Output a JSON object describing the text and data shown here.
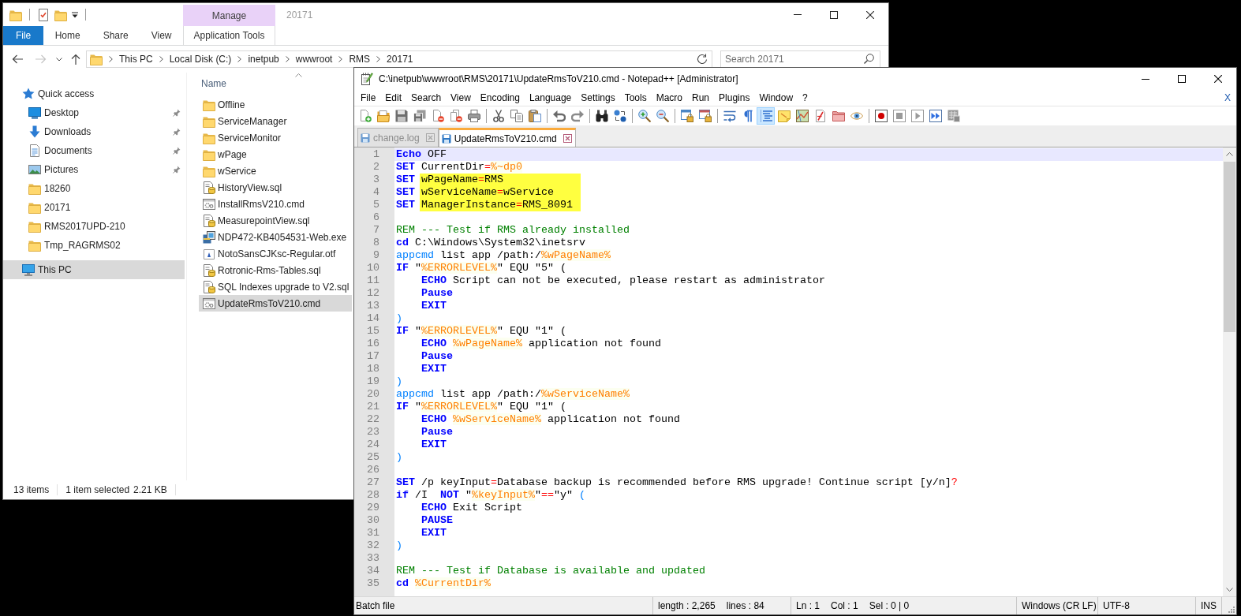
{
  "explorer": {
    "title": "20171",
    "ribbon": {
      "context_group": "Manage",
      "tabs": [
        {
          "label": "File",
          "kind": "file",
          "selected": false
        },
        {
          "label": "Home",
          "kind": "standard",
          "selected": false
        },
        {
          "label": "Share",
          "kind": "standard",
          "selected": false
        },
        {
          "label": "View",
          "kind": "standard",
          "selected": false
        },
        {
          "label": "Application Tools",
          "kind": "contextual",
          "selected": false
        }
      ]
    },
    "navigation": [
      {
        "kind": "back",
        "disabled": false
      },
      {
        "kind": "forward",
        "disabled": true
      },
      {
        "kind": "recent",
        "disabled": false
      },
      {
        "kind": "up",
        "disabled": false
      }
    ],
    "address": [
      "This PC",
      "Local Disk (C:)",
      "inetpub",
      "wwwroot",
      "RMS",
      "20171"
    ],
    "search": {
      "placeholder": "Search 20171"
    },
    "sidebar": [
      {
        "label": "Quick access",
        "kind": "star",
        "pinned": false,
        "selected": false,
        "children": [
          {
            "label": "Desktop",
            "kind": "desktop",
            "pinned": true,
            "selected": false
          },
          {
            "label": "Downloads",
            "kind": "download",
            "pinned": true,
            "selected": false
          },
          {
            "label": "Documents",
            "kind": "documents",
            "pinned": true,
            "selected": false
          },
          {
            "label": "Pictures",
            "kind": "pictures",
            "pinned": true,
            "selected": false
          },
          {
            "label": "18260",
            "kind": "folder",
            "pinned": false,
            "selected": false
          },
          {
            "label": "20171",
            "kind": "folder",
            "pinned": false,
            "selected": false
          },
          {
            "label": "RMS2017UPD-210",
            "kind": "folder",
            "pinned": false,
            "selected": false
          },
          {
            "label": "Tmp_RAGRMS02",
            "kind": "folder",
            "pinned": false,
            "selected": false
          }
        ]
      },
      {
        "label": "This PC",
        "kind": "pc",
        "pinned": false,
        "selected": true
      }
    ],
    "file_list": {
      "column": "Name",
      "sort_ascending": true,
      "items": [
        {
          "name": "Offline",
          "kind": "folder",
          "selected": false
        },
        {
          "name": "ServiceManager",
          "kind": "folder",
          "selected": false
        },
        {
          "name": "ServiceMonitor",
          "kind": "folder",
          "selected": false
        },
        {
          "name": "wPage",
          "kind": "folder",
          "selected": false
        },
        {
          "name": "wService",
          "kind": "folder",
          "selected": false
        },
        {
          "name": "HistoryView.sql",
          "kind": "sql",
          "selected": false
        },
        {
          "name": "InstallRmsV210.cmd",
          "kind": "cmd",
          "selected": false
        },
        {
          "name": "MeasurepointView.sql",
          "kind": "sql",
          "selected": false
        },
        {
          "name": "NDP472-KB4054531-Web.exe",
          "kind": "exe",
          "selected": false
        },
        {
          "name": "NotoSansCJKsc-Regular.otf",
          "kind": "font",
          "selected": false
        },
        {
          "name": "Rotronic-Rms-Tables.sql",
          "kind": "sql",
          "selected": false
        },
        {
          "name": "SQL Indexes upgrade to V2.sql",
          "kind": "sql",
          "selected": false
        },
        {
          "name": "UpdateRmsToV210.cmd",
          "kind": "cmd",
          "selected": true
        }
      ]
    },
    "status_bar": {
      "count": "13 items",
      "selection": "1 item selected",
      "size": "2.21 KB"
    }
  },
  "notepad": {
    "title": "C:\\inetpub\\wwwroot\\RMS\\20171\\UpdateRmsToV210.cmd - Notepad++ [Administrator]",
    "menu": [
      "File",
      "Edit",
      "Search",
      "View",
      "Encoding",
      "Language",
      "Settings",
      "Tools",
      "Macro",
      "Run",
      "Plugins",
      "Window",
      "?"
    ],
    "close_document": "X",
    "toolbar": [
      [
        {
          "kind": "new",
          "pressed": false
        },
        {
          "kind": "open",
          "pressed": false
        },
        {
          "kind": "save",
          "pressed": false
        },
        {
          "kind": "save_all",
          "pressed": false
        },
        {
          "kind": "close",
          "pressed": false
        },
        {
          "kind": "close_all",
          "pressed": false
        },
        {
          "kind": "print",
          "pressed": false
        }
      ],
      [
        {
          "kind": "cut",
          "pressed": false
        },
        {
          "kind": "copy",
          "pressed": false
        },
        {
          "kind": "paste",
          "pressed": false
        }
      ],
      [
        {
          "kind": "undo",
          "pressed": false
        },
        {
          "kind": "redo",
          "pressed": false
        }
      ],
      [
        {
          "kind": "find",
          "pressed": false
        },
        {
          "kind": "replace",
          "pressed": false
        }
      ],
      [
        {
          "kind": "zoom_in",
          "pressed": false
        },
        {
          "kind": "zoom_out",
          "pressed": false
        }
      ],
      [
        {
          "kind": "sync_vertical",
          "pressed": false
        },
        {
          "kind": "sync_horizontal",
          "pressed": false
        }
      ],
      [
        {
          "kind": "word_wrap",
          "pressed": false
        },
        {
          "kind": "all_characters",
          "pressed": false
        },
        {
          "kind": "indent_guide",
          "pressed": true
        },
        {
          "kind": "user_language",
          "pressed": false
        },
        {
          "kind": "document_map",
          "pressed": false
        },
        {
          "kind": "function_list",
          "pressed": false
        },
        {
          "kind": "folder_workspace",
          "pressed": false
        },
        {
          "kind": "monitoring",
          "pressed": false
        }
      ],
      [
        {
          "kind": "record",
          "pressed": false
        },
        {
          "kind": "stop",
          "pressed": false
        },
        {
          "kind": "playback",
          "pressed": false
        },
        {
          "kind": "run_multiple",
          "pressed": false
        },
        {
          "kind": "save_macro",
          "pressed": false
        }
      ]
    ],
    "tabs": [
      {
        "label": "change.log",
        "selected": false
      },
      {
        "label": "UpdateRmsToV210.cmd",
        "selected": true
      }
    ],
    "editor": {
      "lines": [
        {
          "number": "1",
          "current": true,
          "tokens": [
            {
              "text": "Echo",
              "kind": "keyword"
            },
            {
              "text": " OFF",
              "kind": "plain"
            }
          ]
        },
        {
          "number": "2",
          "current": false,
          "tokens": [
            {
              "text": "SET",
              "kind": "keyword"
            },
            {
              "text": " CurrentDir",
              "kind": "plain"
            },
            {
              "text": "=",
              "kind": "operator"
            },
            {
              "text": "%~dp0",
              "kind": "variable"
            }
          ]
        },
        {
          "number": "3",
          "current": false,
          "tokens": [
            {
              "text": "SET ",
              "kind": "keyword"
            }
          ],
          "marked": [
            {
              "text": "wPageName",
              "kind": "plain"
            },
            {
              "text": "=",
              "kind": "operator"
            },
            {
              "text": "RMS",
              "kind": "plain"
            }
          ]
        },
        {
          "number": "4",
          "current": false,
          "tokens": [
            {
              "text": "SET ",
              "kind": "keyword"
            }
          ],
          "marked": [
            {
              "text": "wServiceName",
              "kind": "plain"
            },
            {
              "text": "=",
              "kind": "operator"
            },
            {
              "text": "wService",
              "kind": "plain"
            }
          ]
        },
        {
          "number": "5",
          "current": false,
          "tokens": [
            {
              "text": "SET ",
              "kind": "keyword"
            }
          ],
          "marked": [
            {
              "text": "ManagerInstance",
              "kind": "plain"
            },
            {
              "text": "=",
              "kind": "operator"
            },
            {
              "text": "RMS_8091",
              "kind": "plain"
            }
          ]
        },
        {
          "number": "6",
          "current": false
        },
        {
          "number": "7",
          "current": false,
          "tokens": [
            {
              "text": "REM --- Test if RMS already installed",
              "kind": "comment"
            }
          ]
        },
        {
          "number": "8",
          "current": false,
          "tokens": [
            {
              "text": "cd",
              "kind": "keyword"
            },
            {
              "text": " C:\\Windows\\System32\\inetsrv",
              "kind": "plain"
            }
          ]
        },
        {
          "number": "9",
          "current": false,
          "tokens": [
            {
              "text": "appcmd",
              "kind": "command"
            },
            {
              "text": " list app /path:/",
              "kind": "plain"
            },
            {
              "text": "%wPageName%",
              "kind": "variable"
            }
          ]
        },
        {
          "number": "10",
          "current": false,
          "tokens": [
            {
              "text": "IF",
              "kind": "keyword"
            },
            {
              "text": " \"",
              "kind": "plain"
            },
            {
              "text": "%ERRORLEVEL%",
              "kind": "variable"
            },
            {
              "text": "\" EQU \"5\" (",
              "kind": "plain"
            }
          ]
        },
        {
          "number": "11",
          "current": false,
          "tokens": [
            {
              "text": "    ECHO",
              "kind": "keyword"
            },
            {
              "text": " Script can not be executed, please restart as administrator",
              "kind": "plain"
            }
          ]
        },
        {
          "number": "12",
          "current": false,
          "tokens": [
            {
              "text": "    Pause",
              "kind": "keyword"
            }
          ]
        },
        {
          "number": "13",
          "current": false,
          "tokens": [
            {
              "text": "    EXIT",
              "kind": "keyword"
            }
          ]
        },
        {
          "number": "14",
          "current": false,
          "tokens": [
            {
              "text": ")",
              "kind": "bracket"
            }
          ]
        },
        {
          "number": "15",
          "current": false,
          "tokens": [
            {
              "text": "IF",
              "kind": "keyword"
            },
            {
              "text": " \"",
              "kind": "plain"
            },
            {
              "text": "%ERRORLEVEL%",
              "kind": "variable"
            },
            {
              "text": "\" EQU \"1\" (",
              "kind": "plain"
            }
          ]
        },
        {
          "number": "16",
          "current": false,
          "tokens": [
            {
              "text": "    ECHO ",
              "kind": "keyword"
            },
            {
              "text": "%wPageName%",
              "kind": "variable"
            },
            {
              "text": " application not found",
              "kind": "plain"
            }
          ]
        },
        {
          "number": "17",
          "current": false,
          "tokens": [
            {
              "text": "    Pause",
              "kind": "keyword"
            }
          ]
        },
        {
          "number": "18",
          "current": false,
          "tokens": [
            {
              "text": "    EXIT",
              "kind": "keyword"
            }
          ]
        },
        {
          "number": "19",
          "current": false,
          "tokens": [
            {
              "text": ")",
              "kind": "bracket"
            }
          ]
        },
        {
          "number": "20",
          "current": false,
          "tokens": [
            {
              "text": "appcmd",
              "kind": "command"
            },
            {
              "text": " list app /path:/",
              "kind": "plain"
            },
            {
              "text": "%wServiceName%",
              "kind": "variable"
            }
          ]
        },
        {
          "number": "21",
          "current": false,
          "tokens": [
            {
              "text": "IF",
              "kind": "keyword"
            },
            {
              "text": " \"",
              "kind": "plain"
            },
            {
              "text": "%ERRORLEVEL%",
              "kind": "variable"
            },
            {
              "text": "\" EQU \"1\" (",
              "kind": "plain"
            }
          ]
        },
        {
          "number": "22",
          "current": false,
          "tokens": [
            {
              "text": "    ECHO ",
              "kind": "keyword"
            },
            {
              "text": "%wServiceName%",
              "kind": "variable"
            },
            {
              "text": " application not found",
              "kind": "plain"
            }
          ]
        },
        {
          "number": "23",
          "current": false,
          "tokens": [
            {
              "text": "    Pause",
              "kind": "keyword"
            }
          ]
        },
        {
          "number": "24",
          "current": false,
          "tokens": [
            {
              "text": "    EXIT",
              "kind": "keyword"
            }
          ]
        },
        {
          "number": "25",
          "current": false,
          "tokens": [
            {
              "text": ")",
              "kind": "bracket"
            }
          ]
        },
        {
          "number": "26",
          "current": false
        },
        {
          "number": "27",
          "current": false,
          "tokens": [
            {
              "text": "SET",
              "kind": "keyword"
            },
            {
              "text": " /p keyInput",
              "kind": "plain"
            },
            {
              "text": "=",
              "kind": "operator"
            },
            {
              "text": "Database backup is recommended before RMS upgrade! Continue script [y/n]",
              "kind": "plain"
            },
            {
              "text": "?",
              "kind": "operator"
            }
          ]
        },
        {
          "number": "28",
          "current": false,
          "tokens": [
            {
              "text": "if",
              "kind": "keyword"
            },
            {
              "text": " /I  ",
              "kind": "plain"
            },
            {
              "text": "NOT",
              "kind": "keyword"
            },
            {
              "text": " \"",
              "kind": "plain"
            },
            {
              "text": "%keyInput%",
              "kind": "variable"
            },
            {
              "text": "\"",
              "kind": "plain"
            },
            {
              "text": "==",
              "kind": "operator"
            },
            {
              "text": "\"y\" ",
              "kind": "plain"
            },
            {
              "text": "(",
              "kind": "bracket"
            }
          ]
        },
        {
          "number": "29",
          "current": false,
          "tokens": [
            {
              "text": "    ECHO",
              "kind": "keyword"
            },
            {
              "text": " Exit Script",
              "kind": "plain"
            }
          ]
        },
        {
          "number": "30",
          "current": false,
          "tokens": [
            {
              "text": "    PAUSE",
              "kind": "keyword"
            }
          ]
        },
        {
          "number": "31",
          "current": false,
          "tokens": [
            {
              "text": "    EXIT",
              "kind": "keyword"
            }
          ]
        },
        {
          "number": "32",
          "current": false,
          "tokens": [
            {
              "text": ")",
              "kind": "bracket"
            }
          ]
        },
        {
          "number": "33",
          "current": false
        },
        {
          "number": "34",
          "current": false,
          "tokens": [
            {
              "text": "REM --- Test if Database is available and updated",
              "kind": "comment"
            }
          ]
        },
        {
          "number": "35",
          "current": false,
          "tokens": [
            {
              "text": "cd ",
              "kind": "keyword"
            },
            {
              "text": "%CurrentDir%",
              "kind": "variable"
            }
          ]
        }
      ]
    },
    "status_bar": [
      {
        "fields": [
          "Batch file"
        ]
      },
      {
        "fields": [
          "length : 2,265",
          "lines : 84"
        ]
      },
      {
        "fields": [
          "Ln : 1",
          "Col : 1",
          "Sel : 0 | 0"
        ]
      },
      {
        "fields": [
          "Windows (CR LF)"
        ]
      },
      {
        "fields": [
          "UTF-8"
        ]
      },
      {
        "fields": [
          "INS"
        ]
      }
    ]
  }
}
